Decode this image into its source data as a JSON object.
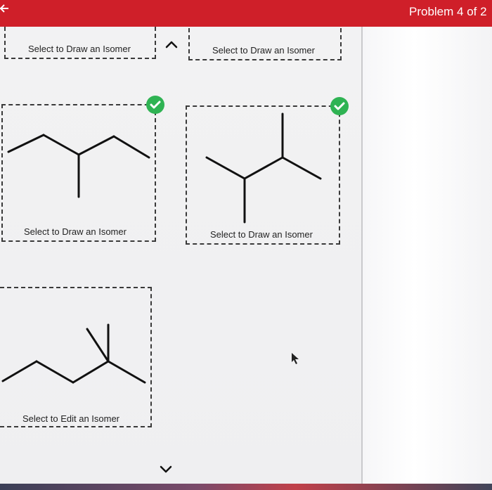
{
  "header": {
    "problem_label": "Problem 4 of 2"
  },
  "tiles": {
    "tile1_label": "Select to Draw an Isomer",
    "tile2_label": "Select to Draw an Isomer",
    "tile3_label": "Select to Draw an Isomer",
    "tile4_label": "Select to Draw an Isomer",
    "tile5_label": "Select to Edit an Isomer"
  },
  "icons": {
    "back": "back-arrow-icon",
    "check": "checkmark-icon",
    "nav_up": "chevron-up-icon",
    "nav_down": "chevron-down-icon",
    "cursor": "mouse-pointer-icon"
  },
  "colors": {
    "header": "#cf1f29",
    "check": "#2fb353"
  }
}
